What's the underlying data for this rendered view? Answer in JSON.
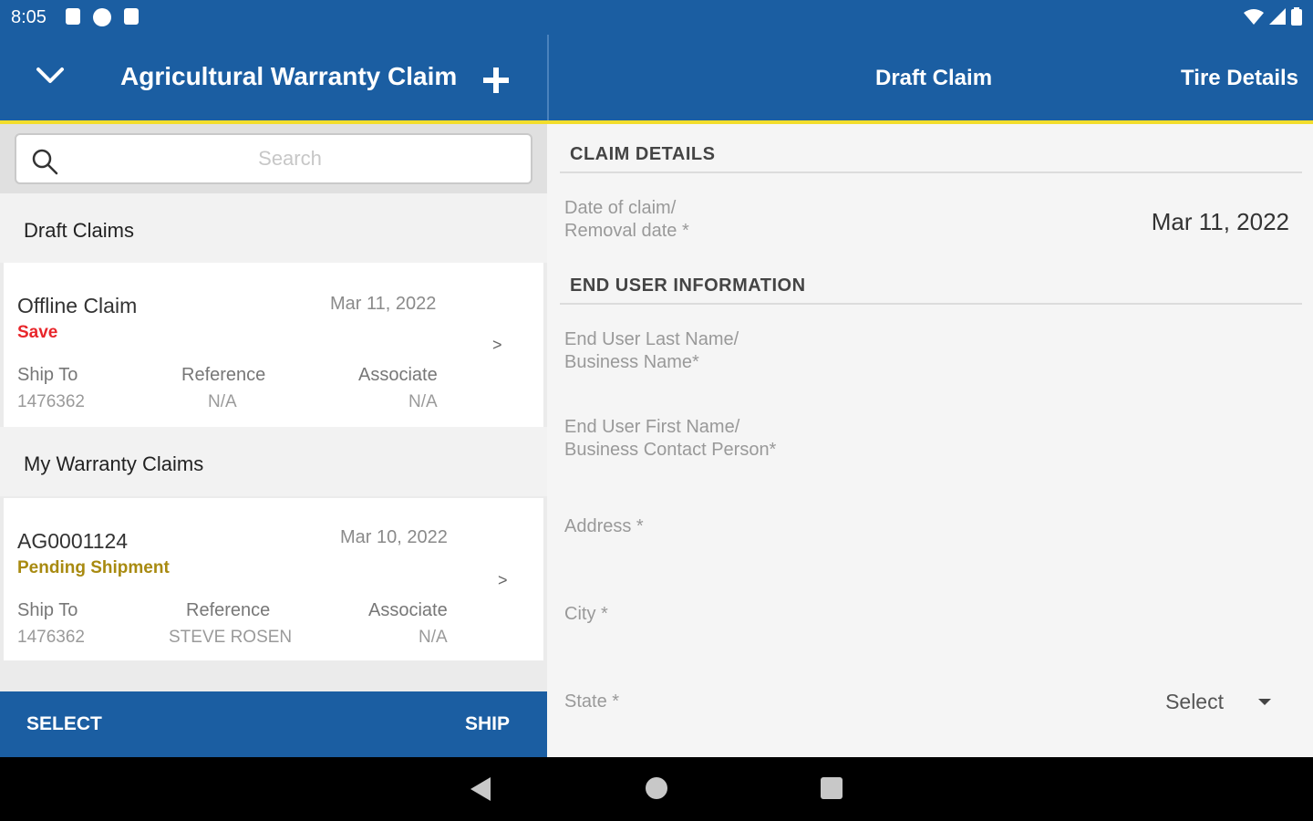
{
  "status_bar": {
    "time": "8:05"
  },
  "left_header": {
    "title": "Agricultural Warranty Claim"
  },
  "right_header": {
    "title": "Draft Claim",
    "tire_details": "Tire Details"
  },
  "search": {
    "placeholder": "Search"
  },
  "sections": {
    "draft": "Draft Claims",
    "mine": "My Warranty Claims"
  },
  "draft_card": {
    "number": "Offline Claim",
    "date": "Mar 11, 2022",
    "status": "Save",
    "status_color": "#e8262b",
    "arrow": ">",
    "ship_to_label": "Ship To",
    "ship_to": "1476362",
    "reference_label": "Reference",
    "reference": "N/A",
    "associate_label": "Associate",
    "associate": "N/A"
  },
  "warranty_card": {
    "number": "AG0001124",
    "date": "Mar 10, 2022",
    "status": "Pending Shipment",
    "status_color": "#a88a10",
    "arrow": ">",
    "ship_to_label": "Ship To",
    "ship_to": "1476362",
    "reference_label": "Reference",
    "reference": "STEVE ROSEN",
    "associate_label": "Associate",
    "associate": "N/A"
  },
  "bottom_bar": {
    "select": "SELECT",
    "ship": "SHIP"
  },
  "claim_details": {
    "header": "CLAIM DETAILS",
    "date_label_1": "Date of claim/",
    "date_label_2": "Removal date *",
    "date_value": "Mar 11, 2022"
  },
  "end_user": {
    "header": "END USER INFORMATION",
    "last_name_1": "End User Last Name/",
    "last_name_2": "Business Name*",
    "first_name_1": "End User First Name/",
    "first_name_2": "Business Contact Person*",
    "address": "Address *",
    "city": "City *",
    "state": "State *",
    "state_value": "Select"
  },
  "colors": {
    "primary": "#1b5ea2",
    "accent_line": "#f2dd2c"
  }
}
